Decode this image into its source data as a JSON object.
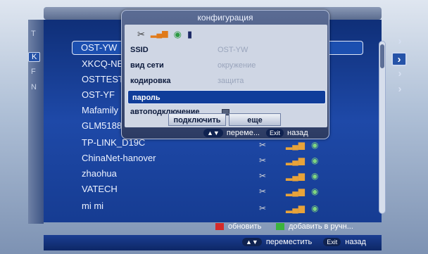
{
  "dialog": {
    "title": "конфигурация",
    "ssid_label": "SSID",
    "ssid_value": "OST-YW",
    "network_type_label": "вид сети",
    "network_type_value": "окружение",
    "encryption_label": "кодировка",
    "encryption_value": "защита",
    "password_label": "пароль",
    "autoconnect_label": "автоподключение",
    "connect_button": "подключить",
    "more_button": "еще",
    "footer_move": "переме...",
    "footer_back": "назад",
    "key_move": "▲▼",
    "key_exit": "Exit"
  },
  "left_letters": [
    "T",
    "K",
    "F",
    "N"
  ],
  "networks": [
    {
      "name": "OST-YW"
    },
    {
      "name": "XKCQ-NE"
    },
    {
      "name": "OSTTEST"
    },
    {
      "name": "OST-YF"
    },
    {
      "name": "Mafamily"
    },
    {
      "name": "GLM5188"
    },
    {
      "name": "TP-LINK_D19C"
    },
    {
      "name": "ChinaNet-hanover"
    },
    {
      "name": "zhaohua"
    },
    {
      "name": "VATECH"
    },
    {
      "name": "mi  mi"
    }
  ],
  "legend": {
    "refresh": "обновить",
    "add_manual": "добавить в ручн..."
  },
  "bottombar": {
    "key_move": "▲▼",
    "move": "переместить",
    "key_exit": "Exit",
    "back": "назад"
  },
  "colors": {
    "red_key": "#d42a2a",
    "green_key": "#3bb43b",
    "panel_blue": "#1e49a8"
  }
}
